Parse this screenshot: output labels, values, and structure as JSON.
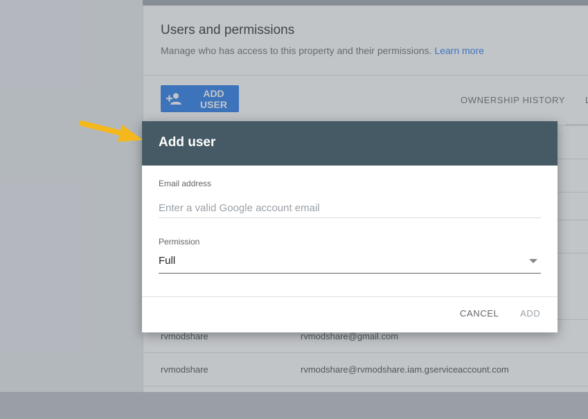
{
  "page": {
    "title": "Users and permissions",
    "subtitle": "Manage who has access to this property and their permissions.",
    "learn_more": "Learn more",
    "add_user_button": "ADD USER",
    "tabs": {
      "ownership_history": "OWNERSHIP HISTORY",
      "partial": "L"
    },
    "rows": [
      {
        "name": "rvmodshare",
        "email": "rvmodshare@gmail.com"
      },
      {
        "name": "rvmodshare",
        "email": "rvmodshare@rvmodshare.iam.gserviceaccount.com"
      }
    ]
  },
  "dialog": {
    "title": "Add user",
    "email_label": "Email address",
    "email_placeholder": "Enter a valid Google account email",
    "email_value": "",
    "permission_label": "Permission",
    "permission_value": "Full",
    "cancel_label": "CANCEL",
    "add_label": "ADD"
  },
  "colors": {
    "dialog_header": "#455a64",
    "primary_button": "#1a73e8",
    "link": "#1a73e8",
    "arrow": "#f5b81c"
  },
  "icons": {
    "add_user": "person-add-icon",
    "permission_dropdown": "caret-down-icon",
    "annotation": "pointer-arrow-icon"
  }
}
